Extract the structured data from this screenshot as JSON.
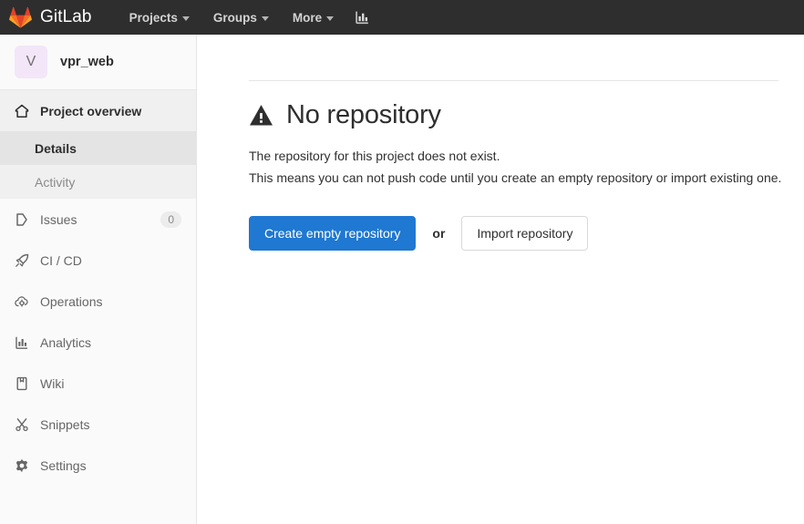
{
  "navbar": {
    "brand_label": "GitLab",
    "brand_logo_icon": "gitlab-fox-logo",
    "items": [
      {
        "label": "Projects",
        "icon": "chevron-down-icon"
      },
      {
        "label": "Groups",
        "icon": "chevron-down-icon"
      },
      {
        "label": "More",
        "icon": "chevron-down-icon"
      }
    ],
    "chart_icon": "bar-chart-icon"
  },
  "sidebar": {
    "project": {
      "avatar_initial": "V",
      "name": "vpr_web"
    },
    "overview": {
      "label": "Project overview",
      "icon": "home-icon",
      "sub_items": [
        {
          "label": "Details",
          "active": true
        },
        {
          "label": "Activity",
          "active": false
        }
      ]
    },
    "items": [
      {
        "label": "Issues",
        "icon": "issues-icon",
        "count": "0"
      },
      {
        "label": "CI / CD",
        "icon": "rocket-icon",
        "count": ""
      },
      {
        "label": "Operations",
        "icon": "cloud-gear-icon",
        "count": ""
      },
      {
        "label": "Analytics",
        "icon": "bar-chart-icon",
        "count": ""
      },
      {
        "label": "Wiki",
        "icon": "book-icon",
        "count": ""
      },
      {
        "label": "Snippets",
        "icon": "scissors-icon",
        "count": ""
      },
      {
        "label": "Settings",
        "icon": "gear-icon",
        "count": ""
      }
    ]
  },
  "main": {
    "warning_icon": "warning-triangle-icon",
    "title": "No repository",
    "desc_line1": "The repository for this project does not exist.",
    "desc_line2": "This means you can not push code until you create an empty repository or import existing one.",
    "create_button_label": "Create empty repository",
    "or_label": "or",
    "import_button_label": "Import repository"
  },
  "colors": {
    "navbar_bg": "#2e2e2e",
    "sidebar_bg": "#fafafa",
    "primary_button": "#1f78d1",
    "avatar_bg": "#f3e6f8"
  }
}
